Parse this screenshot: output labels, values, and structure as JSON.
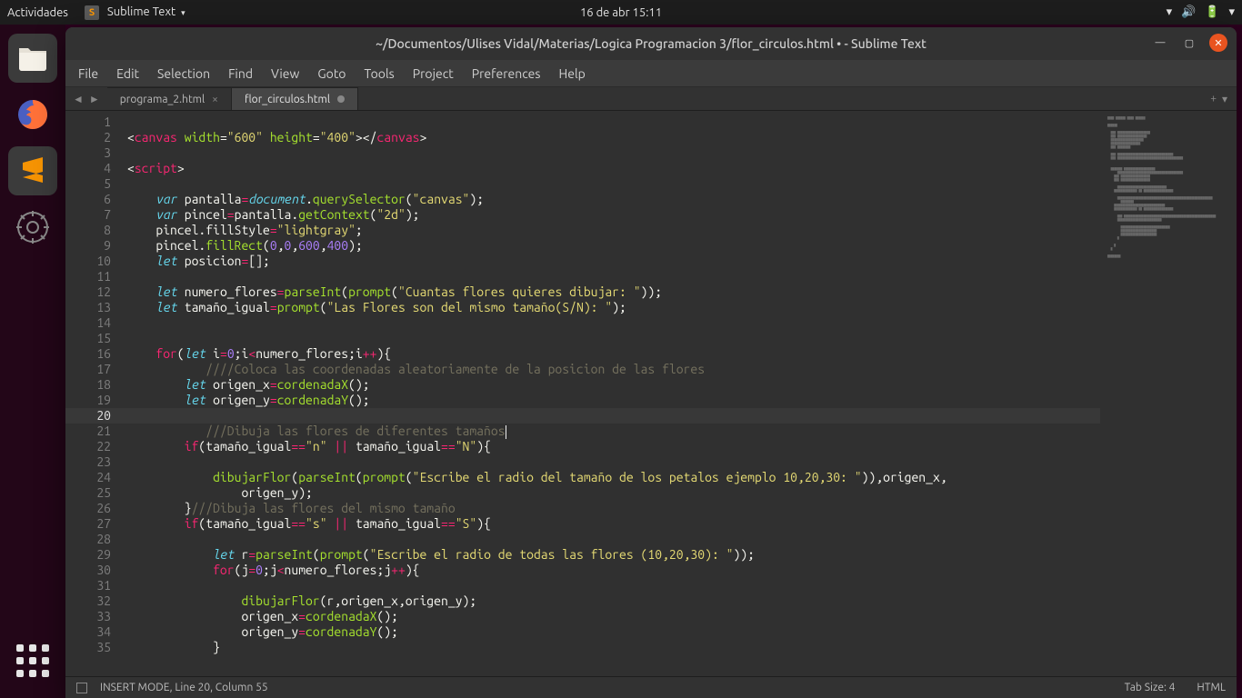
{
  "topbar": {
    "activities": "Actividades",
    "app_name": "Sublime Text",
    "datetime": "16 de abr  15:11"
  },
  "window": {
    "title": "~/Documentos/Ulises Vidal/Materias/Logica Programacion 3/flor_circulos.html • - Sublime Text",
    "menu": {
      "file": "File",
      "edit": "Edit",
      "selection": "Selection",
      "find": "Find",
      "view": "View",
      "goto": "Goto",
      "tools": "Tools",
      "project": "Project",
      "preferences": "Preferences",
      "help": "Help"
    },
    "tabs": [
      {
        "label": "programa_2.html",
        "dirty": false,
        "active": false
      },
      {
        "label": "flor_circulos.html",
        "dirty": true,
        "active": true
      }
    ]
  },
  "status": {
    "mode": "INSERT MODE, Line 20, Column 55",
    "tab_size": "Tab Size: 4",
    "syntax": "HTML"
  },
  "editor": {
    "first_line": 1,
    "last_line": 35,
    "highlighted_line": 20
  },
  "code": {
    "l1_tag_open": "<",
    "l1_canvas": "canvas",
    "l1_attr_w": "width",
    "l1_eq": "=",
    "l1_val_w": "\"600\"",
    "l1_attr_h": "height",
    "l1_val_h": "\"400\"",
    "l1_close1": ">",
    "l1_close2": "</",
    "l1_close3": ">",
    "l3_script": "script",
    "l5_var": "var",
    "l5_name": "pantalla",
    "l5_doc": "document",
    "l5_qs": "querySelector",
    "l5_arg": "\"canvas\"",
    "l6_var": "var",
    "l6_name": "pincel",
    "l6_getctx": "getContext",
    "l6_arg": "\"2d\"",
    "l7_fill": "fillStyle",
    "l7_val": "\"lightgray\"",
    "l8_rect": "fillRect",
    "l8_a": "0",
    "l8_b": "0",
    "l8_c": "600",
    "l8_d": "400",
    "l9_let": "let",
    "l9_name": "posicion",
    "l11_let": "let",
    "l11_name": "numero_flores",
    "l11_pi": "parseInt",
    "l11_pr": "prompt",
    "l11_msg": "\"Cuantas flores quieres dibujar: \"",
    "l12_let": "let",
    "l12_name": "tamaño_igual",
    "l12_pr": "prompt",
    "l12_msg": "\"Las Flores son del mismo tamaño(S/N): \"",
    "l15_for": "for",
    "l15_let": "let",
    "l15_i": "i",
    "l15_z": "0",
    "l15_lt": "<",
    "l15_inc": "++",
    "l16_cm": "////Coloca las coordenadas aleatoriamente de la posicion de las flores",
    "l17_let": "let",
    "l17_name": "origen_x",
    "l17_fn": "cordenadaX",
    "l18_let": "let",
    "l18_name": "origen_y",
    "l18_fn": "cordenadaY",
    "l20_cm": "///Dibuja las flores de diferentes tamaños",
    "l21_if": "if",
    "l21_n": "\"n\"",
    "l21_N": "\"N\"",
    "l21_or": "||",
    "l21_eq": "==",
    "l23_df": "dibujarFlor",
    "l23_pi": "parseInt",
    "l23_pr": "prompt",
    "l23_msg": "\"Escribe el radio del tamaño de los petalos ejemplo 10,20,30: \"",
    "l25_cm": "///Dibuja las flores del mismo tamaño",
    "l26_if": "if",
    "l26_s": "\"s\"",
    "l26_S": "\"S\"",
    "l28_let": "let",
    "l28_r": "r",
    "l28_pi": "parseInt",
    "l28_pr": "prompt",
    "l28_msg": "\"Escribe el radio de todas las flores (10,20,30): \"",
    "l29_for": "for",
    "l29_j": "j",
    "l29_z": "0",
    "l31_df": "dibujarFlor",
    "l32_fn": "cordenadaX",
    "l33_fn": "cordenadaY"
  }
}
